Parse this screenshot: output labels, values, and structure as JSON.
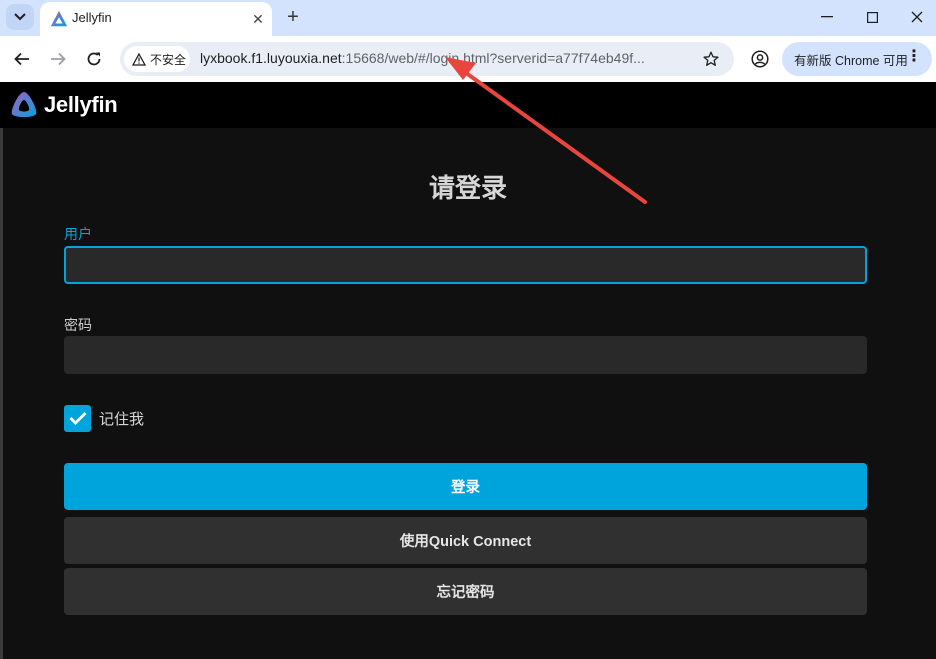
{
  "browser": {
    "tab": {
      "title": "Jellyfin"
    },
    "new_tab_symbol": "+",
    "security_label": "不安全",
    "url_host": "lyxbook.f1.luyouxia.net",
    "url_rest": ":15668/web/#/login.html?serverid=a77f74eb49f...",
    "update_label": "有新版 Chrome 可用",
    "colors": {
      "tabstrip": "#d3e3fd",
      "toolbar": "#ffffff",
      "omnibox": "#e9eef6"
    }
  },
  "header": {
    "brand": "Jellyfin"
  },
  "login": {
    "title": "请登录",
    "user_label": "用户",
    "user_value": "",
    "password_label": "密码",
    "password_value": "",
    "remember_label": "记住我",
    "remember_checked": true,
    "sign_in_button": "登录",
    "quick_connect_button": "使用Quick Connect",
    "forgot_password_button": "忘记密码"
  },
  "icons": {
    "tab_search": "chevron-down-icon",
    "favicon": "jellyfin-logo-icon",
    "back": "arrow-left-icon",
    "forward": "arrow-right-icon",
    "reload": "reload-icon",
    "warning": "warning-triangle-icon",
    "bookmark": "star-icon",
    "profile": "profile-icon",
    "menu": "kebab-menu-icon"
  },
  "colors": {
    "accent": "#00a4dc",
    "annotation_arrow": "#e8463c",
    "page_bg": "#101010"
  }
}
